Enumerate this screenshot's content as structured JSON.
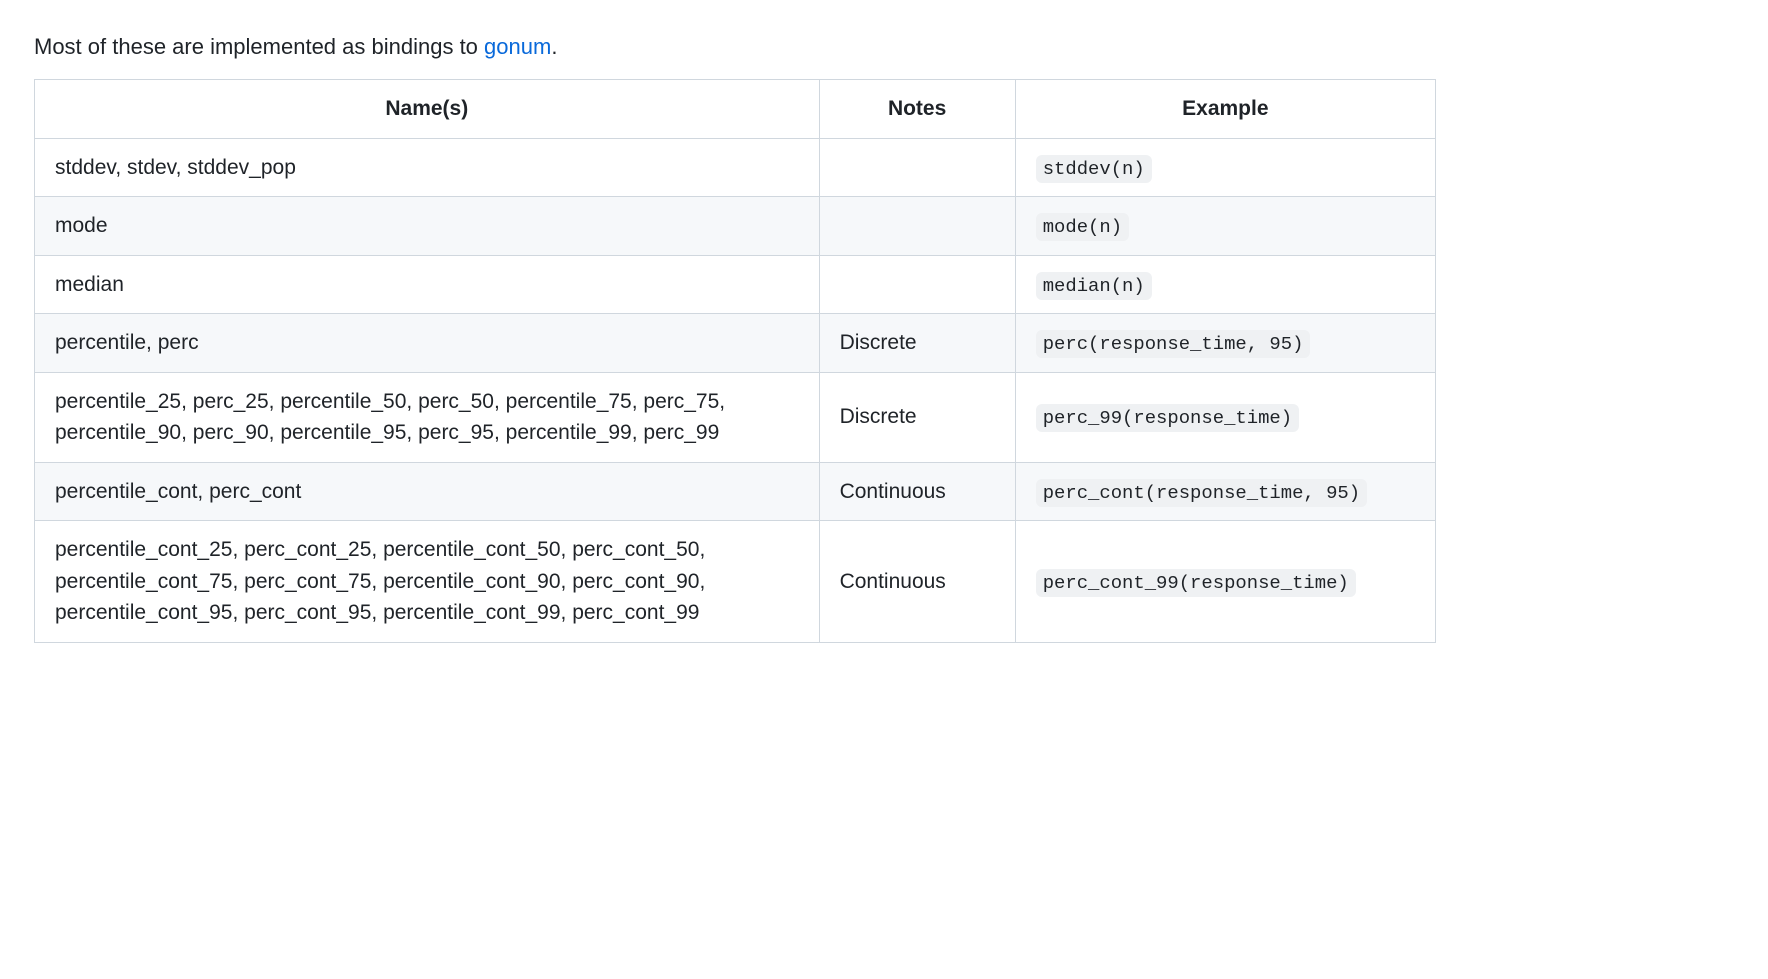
{
  "intro": {
    "prefix": "Most of these are implemented as bindings to ",
    "link_text": "gonum",
    "link_href": "#",
    "suffix": "."
  },
  "table": {
    "headers": {
      "name": "Name(s)",
      "notes": "Notes",
      "example": "Example"
    },
    "rows": [
      {
        "name": "stddev, stdev, stddev_pop",
        "notes": "",
        "example": "stddev(n)"
      },
      {
        "name": "mode",
        "notes": "",
        "example": "mode(n)"
      },
      {
        "name": "median",
        "notes": "",
        "example": "median(n)"
      },
      {
        "name": "percentile, perc",
        "notes": "Discrete",
        "example": "perc(response_time, 95)"
      },
      {
        "name": "percentile_25, perc_25, percentile_50, perc_50, percentile_75, perc_75, percentile_90, perc_90, percentile_95, perc_95, percentile_99, perc_99",
        "notes": "Discrete",
        "example": "perc_99(response_time)"
      },
      {
        "name": "percentile_cont, perc_cont",
        "notes": "Continuous",
        "example": "perc_cont(response_time, 95)"
      },
      {
        "name": "percentile_cont_25, perc_cont_25, percentile_cont_50, perc_cont_50, percentile_cont_75, perc_cont_75, percentile_cont_90, perc_cont_90, percentile_cont_95, perc_cont_95, percentile_cont_99, perc_cont_99",
        "notes": "Continuous",
        "example": "perc_cont_99(response_time)"
      }
    ]
  }
}
